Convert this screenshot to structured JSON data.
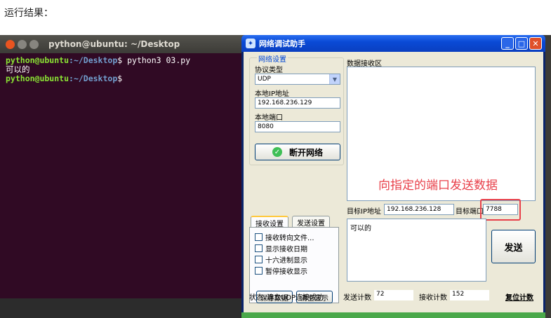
{
  "caption": "运行结果：",
  "terminal": {
    "title": "python@ubuntu: ~/Desktop",
    "lines": [
      {
        "user": "python@ubuntu",
        "path": ":~/Desktop",
        "cmd": "$ python3 03.py"
      },
      {
        "output": "可以的"
      },
      {
        "user": "python@ubuntu",
        "path": ":~/Desktop",
        "cmd": "$"
      }
    ]
  },
  "assistant": {
    "title": "网络调试助手",
    "network_group": {
      "title": "网络设置",
      "protocol_label": "协议类型",
      "protocol_value": "UDP",
      "local_ip_label": "本地IP地址",
      "local_ip_value": "192.168.236.129",
      "local_port_label": "本地端口",
      "local_port_value": "8080",
      "disconnect_button": "断开网络"
    },
    "tabs": {
      "recv_tab": "接收设置",
      "send_tab": "发送设置",
      "options": [
        "接收转向文件...",
        "显示接收日期",
        "十六进制显示",
        "暂停接收显示"
      ],
      "save_button": "保存数据",
      "clear_button": "清空显示"
    },
    "recv_area_label": "数据接收区",
    "annotation": "向指定的端口发送数据",
    "target_ip_label": "目标IP地址",
    "target_ip_value": "192.168.236.128",
    "target_port_label": "目标端口",
    "target_port_value": "7788",
    "send_text": "可以的",
    "send_button": "发送",
    "status_label": "状态",
    "status_value": "建立UDP连接成功",
    "sent_count_label": "发送计数",
    "sent_count_value": "72",
    "recv_count_label": "接收计数",
    "recv_count_value": "152",
    "reset_count": "复位计数"
  }
}
